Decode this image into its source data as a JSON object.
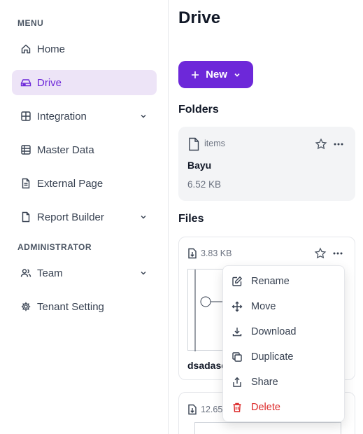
{
  "sidebar": {
    "menu_label": "MENU",
    "admin_label": "ADMINISTRATOR",
    "items": [
      {
        "label": "Home",
        "icon": "home-icon"
      },
      {
        "label": "Drive",
        "icon": "drive-icon",
        "active": true
      },
      {
        "label": "Integration",
        "icon": "grid-icon"
      },
      {
        "label": "Master Data",
        "icon": "table-icon"
      },
      {
        "label": "External Page",
        "icon": "document-icon"
      },
      {
        "label": "Report Builder",
        "icon": "file-icon"
      }
    ],
    "admin_items": [
      {
        "label": "Team",
        "icon": "users-icon"
      },
      {
        "label": "Tenant Setting",
        "icon": "gear-icon"
      }
    ]
  },
  "main": {
    "title": "Drive",
    "new_button": "New",
    "folders_title": "Folders",
    "files_title": "Files",
    "folder": {
      "meta": "items",
      "name": "Bayu",
      "size": "6.52 KB"
    },
    "file1": {
      "size": "3.83 KB",
      "name": "dsadasd"
    },
    "file2": {
      "size": "12.65"
    }
  },
  "context_menu": {
    "items": [
      {
        "label": "Rename",
        "icon": "edit-icon"
      },
      {
        "label": "Move",
        "icon": "move-icon"
      },
      {
        "label": "Download",
        "icon": "download-icon"
      },
      {
        "label": "Duplicate",
        "icon": "copy-icon"
      },
      {
        "label": "Share",
        "icon": "share-icon"
      },
      {
        "label": "Delete",
        "icon": "trash-icon"
      }
    ]
  },
  "colors": {
    "accent": "#6d28d9",
    "active_bg": "#ede4f7",
    "danger": "#dc2626"
  }
}
